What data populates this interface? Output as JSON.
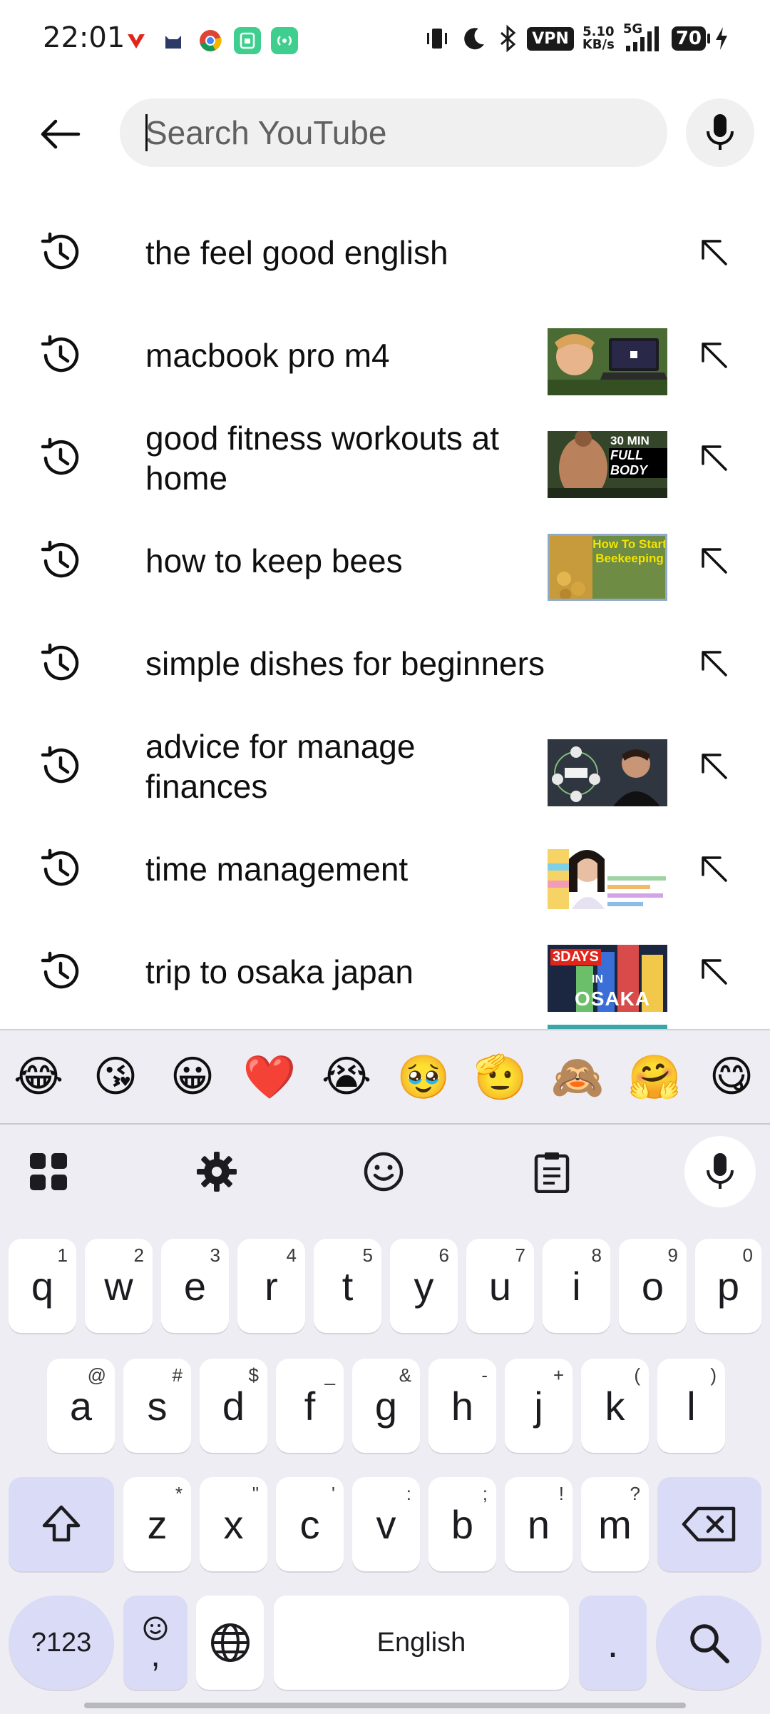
{
  "status_bar": {
    "time": "22:01",
    "vpn": "VPN",
    "net_speed_value": "5.10",
    "net_speed_unit": "KB/s",
    "network": "5G",
    "battery": "70"
  },
  "search": {
    "placeholder": "Search YouTube",
    "value": ""
  },
  "suggestions": [
    {
      "text": "the feel good english",
      "thumb": null
    },
    {
      "text": "macbook pro m4",
      "thumb": "laptop"
    },
    {
      "text": "good fitness workouts at home",
      "thumb": "fitness"
    },
    {
      "text": "how to keep bees",
      "thumb": "bees"
    },
    {
      "text": "simple dishes for beginners",
      "thumb": null
    },
    {
      "text": "advice for manage finances",
      "thumb": "finance"
    },
    {
      "text": "time management",
      "thumb": "time"
    },
    {
      "text": "trip to osaka japan",
      "thumb": "osaka"
    }
  ],
  "thumb_text": {
    "fitness_1": "30 MIN",
    "fitness_2": "FULL BODY",
    "bees": "How To Start Beekeeping",
    "osaka_1": "3DAYS",
    "osaka_2": "IN",
    "osaka_3": "OSAKA"
  },
  "keyboard": {
    "emojis": [
      "😂",
      "😘",
      "😀",
      "❤️",
      "😭",
      "🥹",
      "🫡",
      "🙈",
      "🤗",
      "😋"
    ],
    "row1": [
      {
        "k": "q",
        "h": "1"
      },
      {
        "k": "w",
        "h": "2"
      },
      {
        "k": "e",
        "h": "3"
      },
      {
        "k": "r",
        "h": "4"
      },
      {
        "k": "t",
        "h": "5"
      },
      {
        "k": "y",
        "h": "6"
      },
      {
        "k": "u",
        "h": "7"
      },
      {
        "k": "i",
        "h": "8"
      },
      {
        "k": "o",
        "h": "9"
      },
      {
        "k": "p",
        "h": "0"
      }
    ],
    "row2": [
      {
        "k": "a",
        "h": "@"
      },
      {
        "k": "s",
        "h": "#"
      },
      {
        "k": "d",
        "h": "$"
      },
      {
        "k": "f",
        "h": "_"
      },
      {
        "k": "g",
        "h": "&"
      },
      {
        "k": "h",
        "h": "-"
      },
      {
        "k": "j",
        "h": "+"
      },
      {
        "k": "k",
        "h": "("
      },
      {
        "k": "l",
        "h": ")"
      }
    ],
    "row3": [
      {
        "k": "z",
        "h": "*"
      },
      {
        "k": "x",
        "h": "\""
      },
      {
        "k": "c",
        "h": "'"
      },
      {
        "k": "v",
        "h": ":"
      },
      {
        "k": "b",
        "h": ";"
      },
      {
        "k": "n",
        "h": "!"
      },
      {
        "k": "m",
        "h": "?"
      }
    ],
    "symbols_key": "?123",
    "comma_key": ",",
    "space_label": "English",
    "period_key": "."
  },
  "colors": {
    "accent_key": "#dadcf7",
    "keyboard_bg": "#eeedf4"
  }
}
